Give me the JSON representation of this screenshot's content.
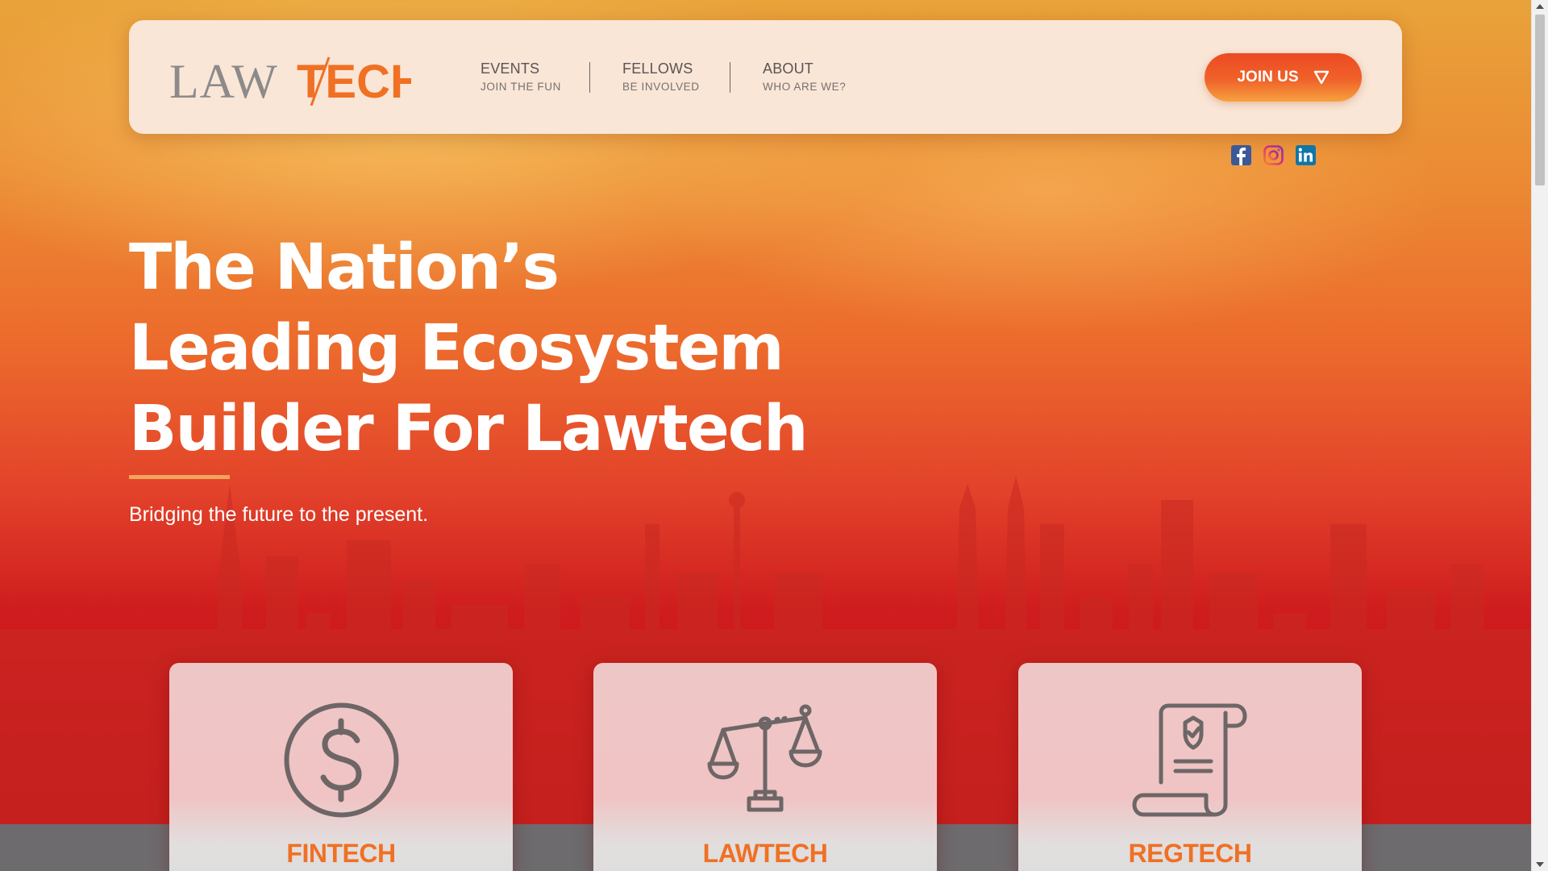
{
  "brand": {
    "logo_part1": "LAW",
    "logo_part2": "TECH",
    "colors": {
      "accent": "#f07024",
      "gray": "#8c8a8b",
      "nav_bg": "#f9e6d6"
    }
  },
  "nav": {
    "items": [
      {
        "label": "EVENTS",
        "sub": "JOIN THE FUN"
      },
      {
        "label": "FELLOWS",
        "sub": "BE INVOLVED"
      },
      {
        "label": "ABOUT",
        "sub": "WHO ARE WE?"
      }
    ],
    "join_label": "JOIN US",
    "join_icon": "triangle-down-icon"
  },
  "social": {
    "icons": [
      "facebook-icon",
      "instagram-icon",
      "linkedin-icon"
    ]
  },
  "hero": {
    "title_lines": [
      "The Nation’s",
      "Leading Ecosystem",
      "Builder For Lawtech"
    ],
    "tagline": "Bridging the future to the present."
  },
  "cards": [
    {
      "label": "FINTECH",
      "icon": "dollar-coin-icon"
    },
    {
      "label": "LAWTECH",
      "icon": "scales-icon"
    },
    {
      "label": "REGTECH",
      "icon": "certificate-scroll-icon"
    }
  ]
}
